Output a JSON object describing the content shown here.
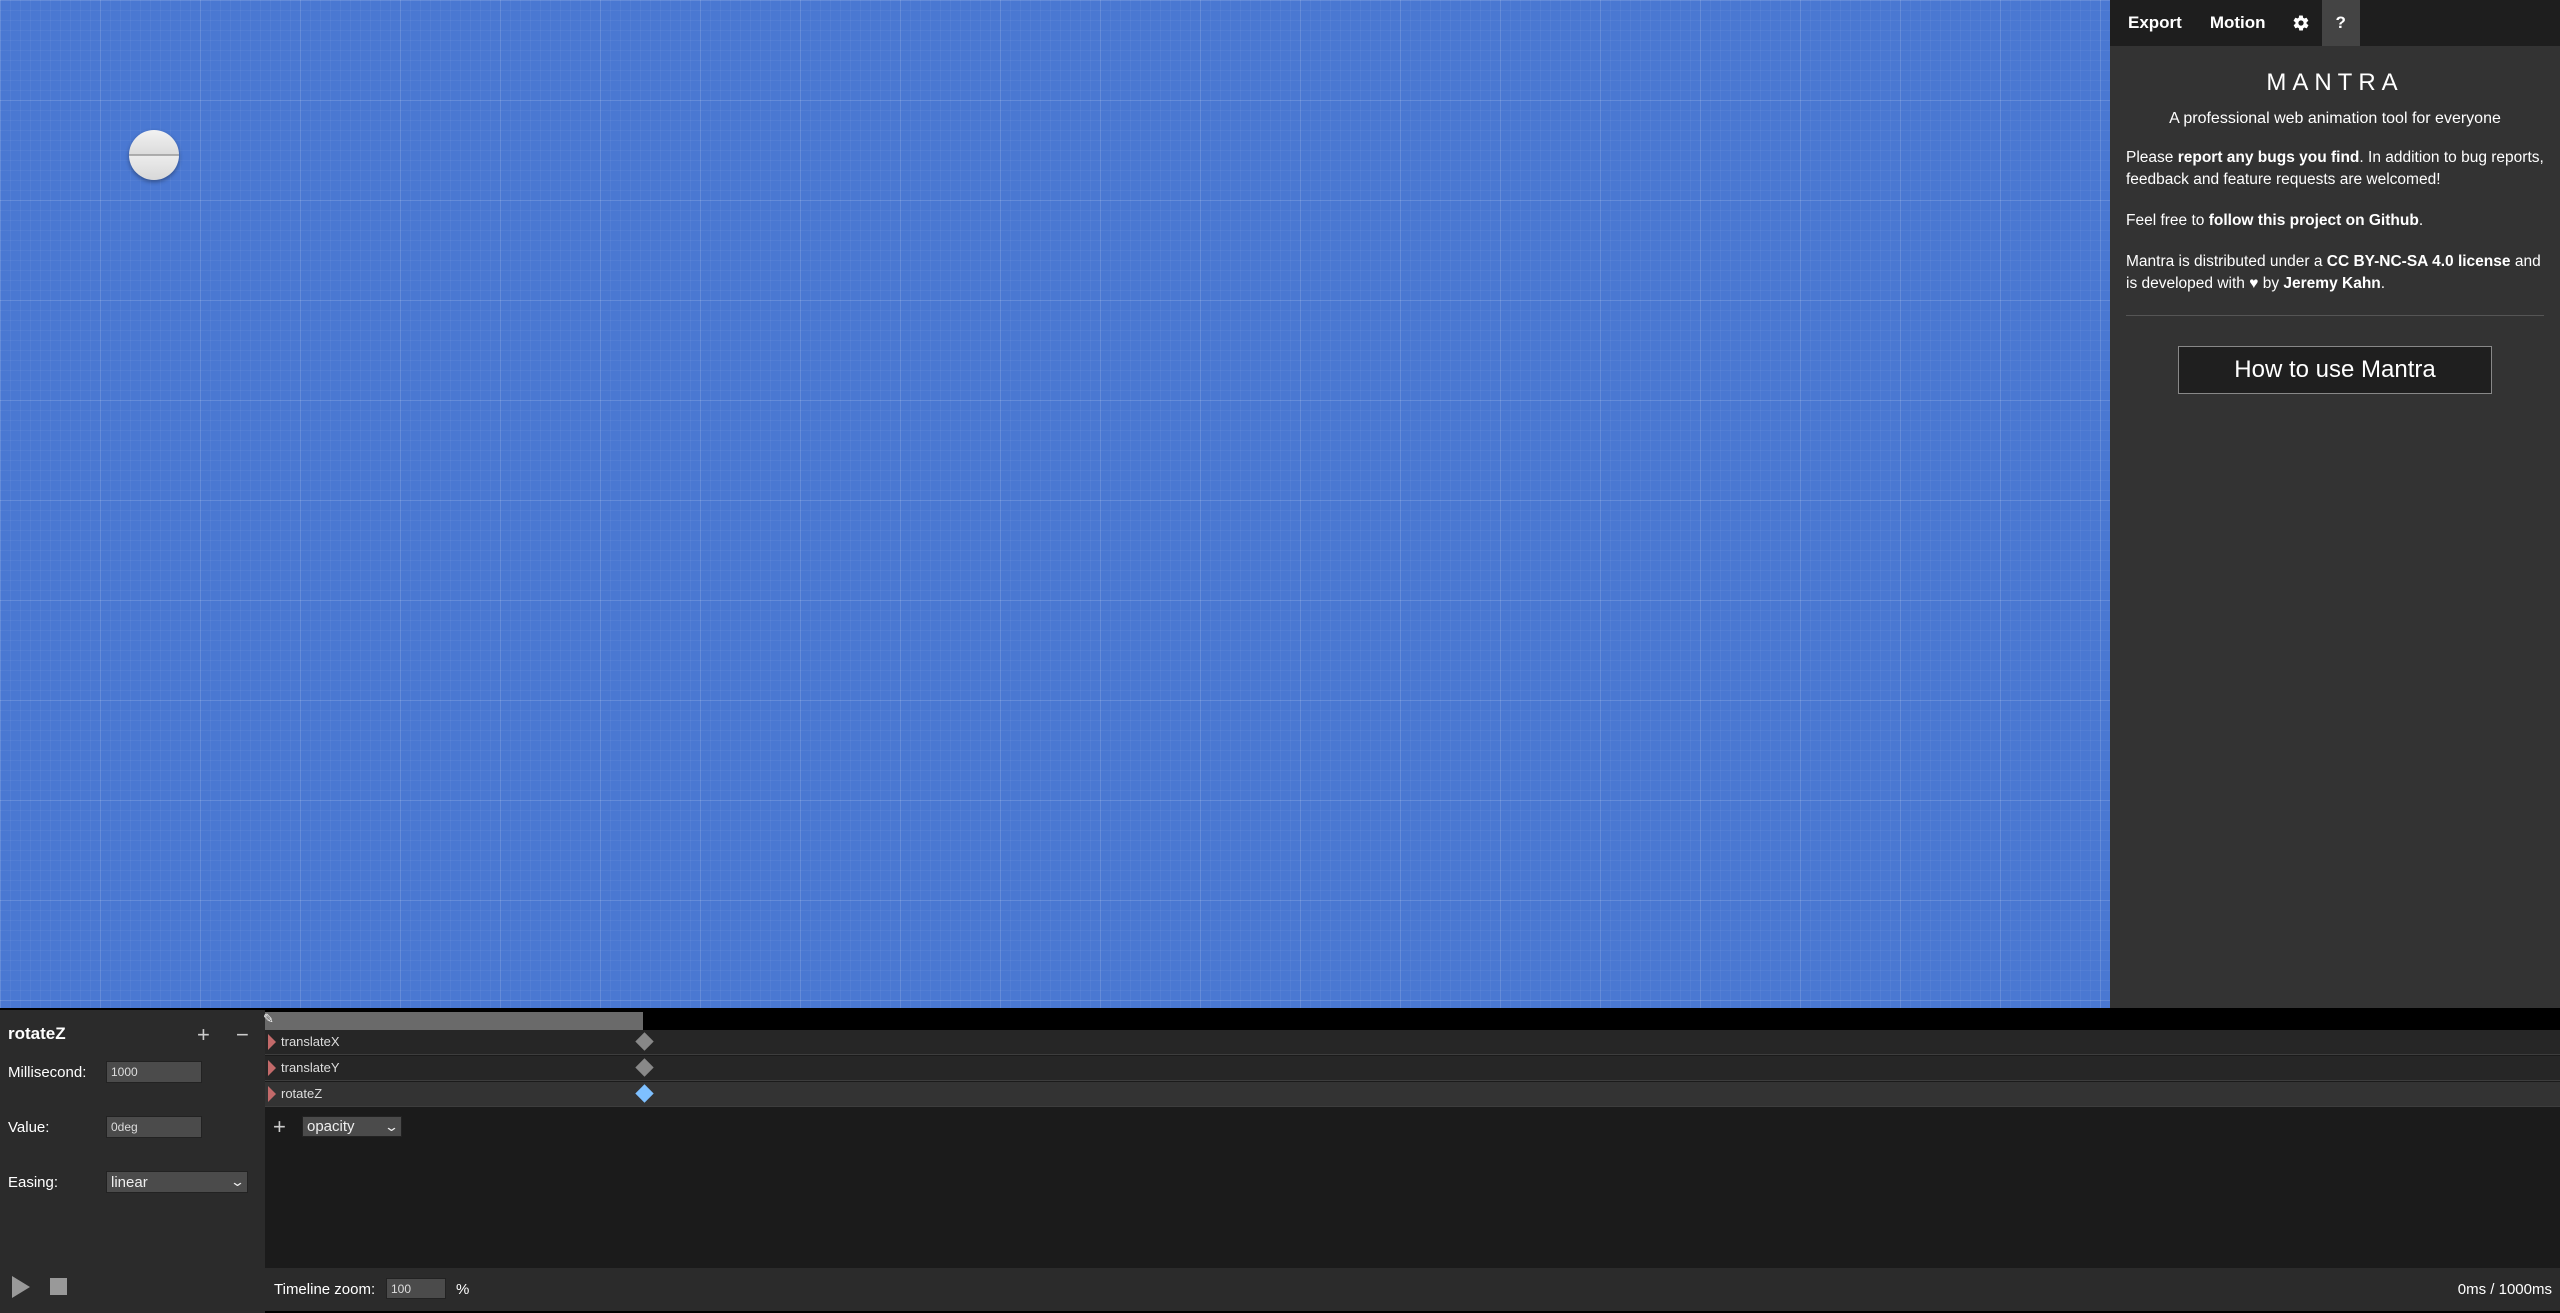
{
  "tabs": {
    "export": "Export",
    "motion": "Motion",
    "settings_icon": "gear-icon",
    "help": "?"
  },
  "about": {
    "title": "MANTRA",
    "tagline": "A professional web animation tool for everyone",
    "p1_a": "Please ",
    "p1_link": "report any bugs you find",
    "p1_b": ". In addition to bug reports, feedback and feature requests are welcomed!",
    "p2_a": "Feel free to ",
    "p2_link": "follow this project on Github",
    "p2_b": ".",
    "p3_a": "Mantra is distributed under a ",
    "p3_link": "CC BY-NC-SA 4.0 license",
    "p3_b": " and is developed with ",
    "p3_heart": "♥",
    "p3_c": " by ",
    "p3_author": "Jeremy Kahn",
    "p3_d": ".",
    "howto_button": "How to use Mantra"
  },
  "keyframe_editor": {
    "property": "rotateZ",
    "add_icon": "+",
    "remove_icon": "−",
    "millisecond_label": "Millisecond:",
    "millisecond_value": "1000",
    "value_label": "Value:",
    "value_value": "0deg",
    "easing_label": "Easing:",
    "easing_value": "linear"
  },
  "timeline": {
    "tracks": [
      {
        "name": "translateX",
        "selected": false
      },
      {
        "name": "translateY",
        "selected": false
      },
      {
        "name": "rotateZ",
        "selected": true
      }
    ],
    "add_icon": "+",
    "new_property": "opacity",
    "zoom_label": "Timeline zoom:",
    "zoom_value": "100",
    "zoom_unit": "%",
    "time_readout": "0ms / 1000ms"
  },
  "colors": {
    "stage": "#4a78d2",
    "selected_keyframe": "#7ec0ff",
    "track_marker": "#c36a6a"
  }
}
